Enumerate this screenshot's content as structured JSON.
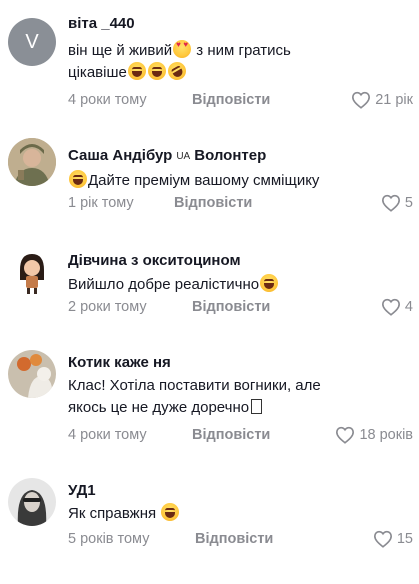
{
  "comments": [
    {
      "avatar_letter": "V",
      "username": "віта _440",
      "text_1": "він ще й живий",
      "text_2": " з ним гратись",
      "text_3": "цікавіше",
      "time": "4 роки тому",
      "reply": "Відповісти",
      "likes": "21 рік"
    },
    {
      "username": "Саша Андібур",
      "country_code": "UA",
      "username_suffix": "Волонтер",
      "text": "Дайте преміум вашому смміщику",
      "time": "1 рік тому",
      "reply": "Відповісти",
      "likes": "5"
    },
    {
      "username": "Дівчина з окситоцином",
      "text": "Вийшло добре реалістично",
      "time": "2 роки тому",
      "reply": "Відповісти",
      "likes": "4"
    },
    {
      "username": "Котик каже ня",
      "text_1": "Клас! Хотіла поставити вогники, але",
      "text_2": "якось це не дуже доречно",
      "time": "4 роки тому",
      "reply": "Відповісти",
      "likes": "18 років"
    },
    {
      "username": "УД1",
      "text": "Як справжня",
      "time": "5 років тому",
      "reply": "Відповісти",
      "likes": "15"
    }
  ],
  "icons": {
    "like": "heart-outline-icon"
  },
  "colors": {
    "text": "#161823",
    "secondary": "#8a8b91",
    "letter_avatar": "#8a8f96"
  }
}
